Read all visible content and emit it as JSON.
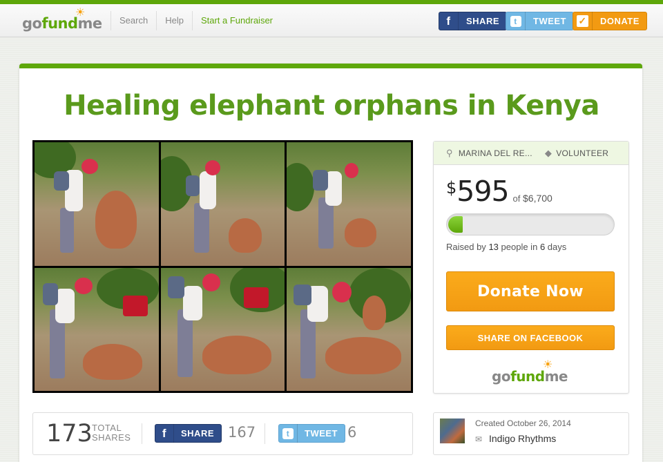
{
  "header": {
    "logo": {
      "go": "go",
      "fund": "fund",
      "me": "me"
    },
    "nav": [
      "Search",
      "Help",
      "Start a Fundraiser"
    ],
    "share_label": "SHARE",
    "tweet_label": "TWEET",
    "donate_label": "DONATE"
  },
  "campaign": {
    "title": "Healing elephant orphans in Kenya",
    "location": "MARINA DEL RE...",
    "category": "VOLUNTEER",
    "currency": "$",
    "raised": "595",
    "goal_text": "of",
    "goal": "$6,700",
    "progress_fraction": 0.089,
    "raised_by_prefix": "Raised by",
    "people": "13",
    "people_suffix": "people in",
    "days": "6",
    "days_suffix": "days",
    "donate_now": "Donate Now",
    "share_facebook": "SHARE ON FACEBOOK"
  },
  "shares": {
    "total": "173",
    "total_label_1": "TOTAL",
    "total_label_2": "SHARES",
    "share_label": "SHARE",
    "share_count": "167",
    "tweet_label": "TWEET",
    "tweet_count": "6"
  },
  "creator": {
    "created": "Created October 26, 2014",
    "name": "Indigo Rhythms"
  },
  "colors": {
    "brand_green": "#5ea70a",
    "orange": "#f29a12",
    "facebook": "#2f4d8a",
    "twitter": "#70b7e4"
  }
}
